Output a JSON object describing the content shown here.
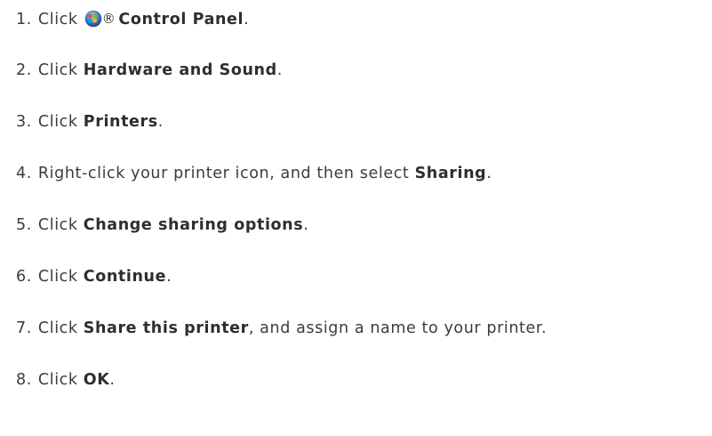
{
  "steps": [
    {
      "number": "1.",
      "pre": "Click ",
      "icon": "windows-start-icon",
      "reg_mark": "®",
      "bold": "Control Panel",
      "post": "."
    },
    {
      "number": "2.",
      "pre": "Click ",
      "bold": "Hardware and Sound",
      "post": "."
    },
    {
      "number": "3.",
      "pre": "Click ",
      "bold": "Printers",
      "post": "."
    },
    {
      "number": "4.",
      "pre": "Right-click your printer icon, and then select ",
      "bold": "Sharing",
      "post": "."
    },
    {
      "number": "5.",
      "pre": "Click ",
      "bold": "Change sharing options",
      "post": "."
    },
    {
      "number": "6.",
      "pre": "Click ",
      "bold": "Continue",
      "post": "."
    },
    {
      "number": "7.",
      "pre": "Click ",
      "bold": "Share this printer",
      "post": ", and assign a name to your printer."
    },
    {
      "number": "8.",
      "pre": "Click ",
      "bold": "OK",
      "post": "."
    }
  ]
}
